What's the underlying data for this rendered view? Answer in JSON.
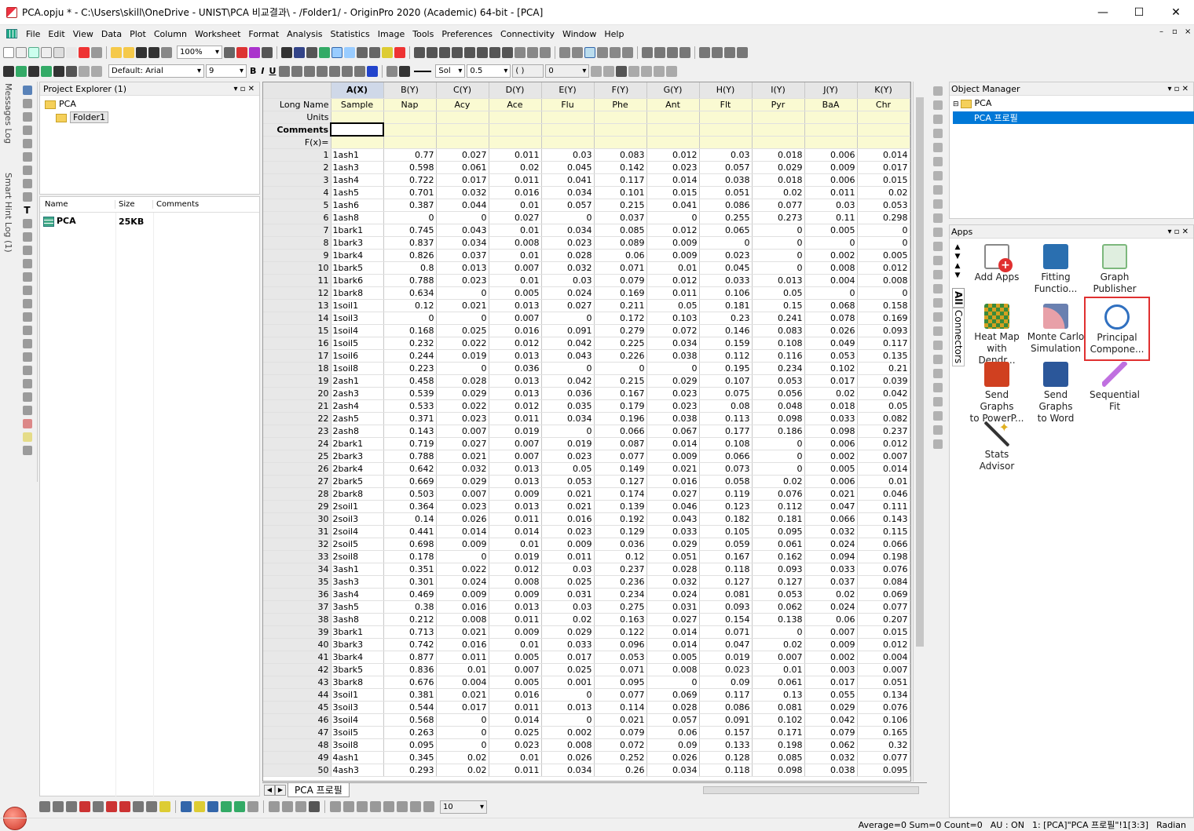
{
  "window": {
    "title": "PCA.opju * - C:\\Users\\skill\\OneDrive - UNIST\\PCA 비교결과\\ - /Folder1/ - OriginPro 2020 (Academic) 64-bit - [PCA]",
    "min": "—",
    "max": "☐",
    "close": "✕"
  },
  "menu": [
    "File",
    "Edit",
    "View",
    "Data",
    "Plot",
    "Column",
    "Worksheet",
    "Format",
    "Analysis",
    "Statistics",
    "Image",
    "Tools",
    "Preferences",
    "Connectivity",
    "Window",
    "Help"
  ],
  "toolbar": {
    "zoom": "100%",
    "font": "Default: Arial",
    "size": "9",
    "linestyle": "Sol",
    "linewidth": "0.5",
    "value0": "0",
    "bottom_value": "10"
  },
  "side_tabs": {
    "messages": "Messages Log",
    "smarthint": "Smart Hint Log (1)"
  },
  "project_explorer": {
    "title": "Project Explorer (1)",
    "root": "PCA",
    "folder": "Folder1",
    "col_name": "Name",
    "col_size": "Size",
    "col_comments": "Comments",
    "item_name": "PCA",
    "item_size": "25KB"
  },
  "worksheet": {
    "columns": [
      "A(X)",
      "B(Y)",
      "C(Y)",
      "D(Y)",
      "E(Y)",
      "F(Y)",
      "G(Y)",
      "H(Y)",
      "I(Y)",
      "J(Y)",
      "K(Y)"
    ],
    "longnames": [
      "Sample",
      "Nap",
      "Acy",
      "Ace",
      "Flu",
      "Phe",
      "Ant",
      "Flt",
      "Pyr",
      "BaA",
      "Chr"
    ],
    "meta_labels": [
      "Long Name",
      "Units",
      "Comments",
      "F(x)="
    ],
    "rows": [
      [
        "1",
        "1ash1",
        "0.77",
        "0.027",
        "0.011",
        "0.03",
        "0.083",
        "0.012",
        "0.03",
        "0.018",
        "0.006",
        "0.014"
      ],
      [
        "2",
        "1ash3",
        "0.598",
        "0.061",
        "0.02",
        "0.045",
        "0.142",
        "0.023",
        "0.057",
        "0.029",
        "0.009",
        "0.017"
      ],
      [
        "3",
        "1ash4",
        "0.722",
        "0.017",
        "0.011",
        "0.041",
        "0.117",
        "0.014",
        "0.038",
        "0.018",
        "0.006",
        "0.015"
      ],
      [
        "4",
        "1ash5",
        "0.701",
        "0.032",
        "0.016",
        "0.034",
        "0.101",
        "0.015",
        "0.051",
        "0.02",
        "0.011",
        "0.02"
      ],
      [
        "5",
        "1ash6",
        "0.387",
        "0.044",
        "0.01",
        "0.057",
        "0.215",
        "0.041",
        "0.086",
        "0.077",
        "0.03",
        "0.053"
      ],
      [
        "6",
        "1ash8",
        "0",
        "0",
        "0.027",
        "0",
        "0.037",
        "0",
        "0.255",
        "0.273",
        "0.11",
        "0.298"
      ],
      [
        "7",
        "1bark1",
        "0.745",
        "0.043",
        "0.01",
        "0.034",
        "0.085",
        "0.012",
        "0.065",
        "0",
        "0.005",
        "0"
      ],
      [
        "8",
        "1bark3",
        "0.837",
        "0.034",
        "0.008",
        "0.023",
        "0.089",
        "0.009",
        "0",
        "0",
        "0",
        "0"
      ],
      [
        "9",
        "1bark4",
        "0.826",
        "0.037",
        "0.01",
        "0.028",
        "0.06",
        "0.009",
        "0.023",
        "0",
        "0.002",
        "0.005"
      ],
      [
        "10",
        "1bark5",
        "0.8",
        "0.013",
        "0.007",
        "0.032",
        "0.071",
        "0.01",
        "0.045",
        "0",
        "0.008",
        "0.012"
      ],
      [
        "11",
        "1bark6",
        "0.788",
        "0.023",
        "0.01",
        "0.03",
        "0.079",
        "0.012",
        "0.033",
        "0.013",
        "0.004",
        "0.008"
      ],
      [
        "12",
        "1bark8",
        "0.634",
        "0",
        "0.005",
        "0.024",
        "0.169",
        "0.011",
        "0.106",
        "0.05",
        "0",
        "0"
      ],
      [
        "13",
        "1soil1",
        "0.12",
        "0.021",
        "0.013",
        "0.027",
        "0.211",
        "0.05",
        "0.181",
        "0.15",
        "0.068",
        "0.158"
      ],
      [
        "14",
        "1soil3",
        "0",
        "0",
        "0.007",
        "0",
        "0.172",
        "0.103",
        "0.23",
        "0.241",
        "0.078",
        "0.169"
      ],
      [
        "15",
        "1soil4",
        "0.168",
        "0.025",
        "0.016",
        "0.091",
        "0.279",
        "0.072",
        "0.146",
        "0.083",
        "0.026",
        "0.093"
      ],
      [
        "16",
        "1soil5",
        "0.232",
        "0.022",
        "0.012",
        "0.042",
        "0.225",
        "0.034",
        "0.159",
        "0.108",
        "0.049",
        "0.117"
      ],
      [
        "17",
        "1soil6",
        "0.244",
        "0.019",
        "0.013",
        "0.043",
        "0.226",
        "0.038",
        "0.112",
        "0.116",
        "0.053",
        "0.135"
      ],
      [
        "18",
        "1soil8",
        "0.223",
        "0",
        "0.036",
        "0",
        "0",
        "0",
        "0.195",
        "0.234",
        "0.102",
        "0.21"
      ],
      [
        "19",
        "2ash1",
        "0.458",
        "0.028",
        "0.013",
        "0.042",
        "0.215",
        "0.029",
        "0.107",
        "0.053",
        "0.017",
        "0.039"
      ],
      [
        "20",
        "2ash3",
        "0.539",
        "0.029",
        "0.013",
        "0.036",
        "0.167",
        "0.023",
        "0.075",
        "0.056",
        "0.02",
        "0.042"
      ],
      [
        "21",
        "2ash4",
        "0.533",
        "0.022",
        "0.012",
        "0.035",
        "0.179",
        "0.023",
        "0.08",
        "0.048",
        "0.018",
        "0.05"
      ],
      [
        "22",
        "2ash5",
        "0.371",
        "0.023",
        "0.011",
        "0.034",
        "0.196",
        "0.038",
        "0.113",
        "0.098",
        "0.033",
        "0.082"
      ],
      [
        "23",
        "2ash8",
        "0.143",
        "0.007",
        "0.019",
        "0",
        "0.066",
        "0.067",
        "0.177",
        "0.186",
        "0.098",
        "0.237"
      ],
      [
        "24",
        "2bark1",
        "0.719",
        "0.027",
        "0.007",
        "0.019",
        "0.087",
        "0.014",
        "0.108",
        "0",
        "0.006",
        "0.012"
      ],
      [
        "25",
        "2bark3",
        "0.788",
        "0.021",
        "0.007",
        "0.023",
        "0.077",
        "0.009",
        "0.066",
        "0",
        "0.002",
        "0.007"
      ],
      [
        "26",
        "2bark4",
        "0.642",
        "0.032",
        "0.013",
        "0.05",
        "0.149",
        "0.021",
        "0.073",
        "0",
        "0.005",
        "0.014"
      ],
      [
        "27",
        "2bark5",
        "0.669",
        "0.029",
        "0.013",
        "0.053",
        "0.127",
        "0.016",
        "0.058",
        "0.02",
        "0.006",
        "0.01"
      ],
      [
        "28",
        "2bark8",
        "0.503",
        "0.007",
        "0.009",
        "0.021",
        "0.174",
        "0.027",
        "0.119",
        "0.076",
        "0.021",
        "0.046"
      ],
      [
        "29",
        "2soil1",
        "0.364",
        "0.023",
        "0.013",
        "0.021",
        "0.139",
        "0.046",
        "0.123",
        "0.112",
        "0.047",
        "0.111"
      ],
      [
        "30",
        "2soil3",
        "0.14",
        "0.026",
        "0.011",
        "0.016",
        "0.192",
        "0.043",
        "0.182",
        "0.181",
        "0.066",
        "0.143"
      ],
      [
        "31",
        "2soil4",
        "0.441",
        "0.014",
        "0.014",
        "0.023",
        "0.129",
        "0.033",
        "0.105",
        "0.095",
        "0.032",
        "0.115"
      ],
      [
        "32",
        "2soil5",
        "0.698",
        "0.009",
        "0.01",
        "0.009",
        "0.036",
        "0.029",
        "0.059",
        "0.061",
        "0.024",
        "0.066"
      ],
      [
        "33",
        "2soil8",
        "0.178",
        "0",
        "0.019",
        "0.011",
        "0.12",
        "0.051",
        "0.167",
        "0.162",
        "0.094",
        "0.198"
      ],
      [
        "34",
        "3ash1",
        "0.351",
        "0.022",
        "0.012",
        "0.03",
        "0.237",
        "0.028",
        "0.118",
        "0.093",
        "0.033",
        "0.076"
      ],
      [
        "35",
        "3ash3",
        "0.301",
        "0.024",
        "0.008",
        "0.025",
        "0.236",
        "0.032",
        "0.127",
        "0.127",
        "0.037",
        "0.084"
      ],
      [
        "36",
        "3ash4",
        "0.469",
        "0.009",
        "0.009",
        "0.031",
        "0.234",
        "0.024",
        "0.081",
        "0.053",
        "0.02",
        "0.069"
      ],
      [
        "37",
        "3ash5",
        "0.38",
        "0.016",
        "0.013",
        "0.03",
        "0.275",
        "0.031",
        "0.093",
        "0.062",
        "0.024",
        "0.077"
      ],
      [
        "38",
        "3ash8",
        "0.212",
        "0.008",
        "0.011",
        "0.02",
        "0.163",
        "0.027",
        "0.154",
        "0.138",
        "0.06",
        "0.207"
      ],
      [
        "39",
        "3bark1",
        "0.713",
        "0.021",
        "0.009",
        "0.029",
        "0.122",
        "0.014",
        "0.071",
        "0",
        "0.007",
        "0.015"
      ],
      [
        "40",
        "3bark3",
        "0.742",
        "0.016",
        "0.01",
        "0.033",
        "0.096",
        "0.014",
        "0.047",
        "0.02",
        "0.009",
        "0.012"
      ],
      [
        "41",
        "3bark4",
        "0.877",
        "0.011",
        "0.005",
        "0.017",
        "0.053",
        "0.005",
        "0.019",
        "0.007",
        "0.002",
        "0.004"
      ],
      [
        "42",
        "3bark5",
        "0.836",
        "0.01",
        "0.007",
        "0.025",
        "0.071",
        "0.008",
        "0.023",
        "0.01",
        "0.003",
        "0.007"
      ],
      [
        "43",
        "3bark8",
        "0.676",
        "0.004",
        "0.005",
        "0.001",
        "0.095",
        "0",
        "0.09",
        "0.061",
        "0.017",
        "0.051"
      ],
      [
        "44",
        "3soil1",
        "0.381",
        "0.021",
        "0.016",
        "0",
        "0.077",
        "0.069",
        "0.117",
        "0.13",
        "0.055",
        "0.134"
      ],
      [
        "45",
        "3soil3",
        "0.544",
        "0.017",
        "0.011",
        "0.013",
        "0.114",
        "0.028",
        "0.086",
        "0.081",
        "0.029",
        "0.076"
      ],
      [
        "46",
        "3soil4",
        "0.568",
        "0",
        "0.014",
        "0",
        "0.021",
        "0.057",
        "0.091",
        "0.102",
        "0.042",
        "0.106"
      ],
      [
        "47",
        "3soil5",
        "0.263",
        "0",
        "0.025",
        "0.002",
        "0.079",
        "0.06",
        "0.157",
        "0.171",
        "0.079",
        "0.165"
      ],
      [
        "48",
        "3soil8",
        "0.095",
        "0",
        "0.023",
        "0.008",
        "0.072",
        "0.09",
        "0.133",
        "0.198",
        "0.062",
        "0.32"
      ],
      [
        "49",
        "4ash1",
        "0.345",
        "0.02",
        "0.01",
        "0.026",
        "0.252",
        "0.026",
        "0.128",
        "0.085",
        "0.032",
        "0.077"
      ],
      [
        "50",
        "4ash3",
        "0.293",
        "0.02",
        "0.011",
        "0.034",
        "0.26",
        "0.034",
        "0.118",
        "0.098",
        "0.038",
        "0.095"
      ]
    ],
    "sheet_tab": "PCA 프로필"
  },
  "object_manager": {
    "title": "Object Manager",
    "root": "PCA",
    "item": "PCA 프로필"
  },
  "apps": {
    "title": "Apps",
    "side_tabs": [
      "All",
      "Connectors"
    ],
    "items": [
      {
        "line1": "Add Apps",
        "line2": "",
        "color": "#e03030"
      },
      {
        "line1": "Fitting",
        "line2": "Functio...",
        "color": "#2a6fb0"
      },
      {
        "line1": "Graph",
        "line2": "Publisher",
        "color": "#7cb87c"
      },
      {
        "line1": "Heat Map",
        "line2": "with Dendr...",
        "color": "#d4a020"
      },
      {
        "line1": "Monte Carlo",
        "line2": "Simulation",
        "color": "#c05060"
      },
      {
        "line1": "Principal",
        "line2": "Compone...",
        "color": "#3070c0"
      },
      {
        "line1": "Send Graphs",
        "line2": "to PowerP...",
        "color": "#d04020"
      },
      {
        "line1": "Send Graphs",
        "line2": "to Word",
        "color": "#2b579a"
      },
      {
        "line1": "Sequential",
        "line2": "Fit",
        "color": "#a040c0"
      },
      {
        "line1": "Stats Advisor",
        "line2": "",
        "color": "#e0b020"
      }
    ]
  },
  "status": {
    "stats": "Average=0 Sum=0 Count=0",
    "au": "AU : ON",
    "cell": "1: [PCA]\"PCA 프로필\"!1[3:3]",
    "angle": "Radian"
  },
  "colors": {
    "highlight": "#0078d7",
    "meta_bg": "#fafad2",
    "selected_app_border": "#e03030"
  }
}
